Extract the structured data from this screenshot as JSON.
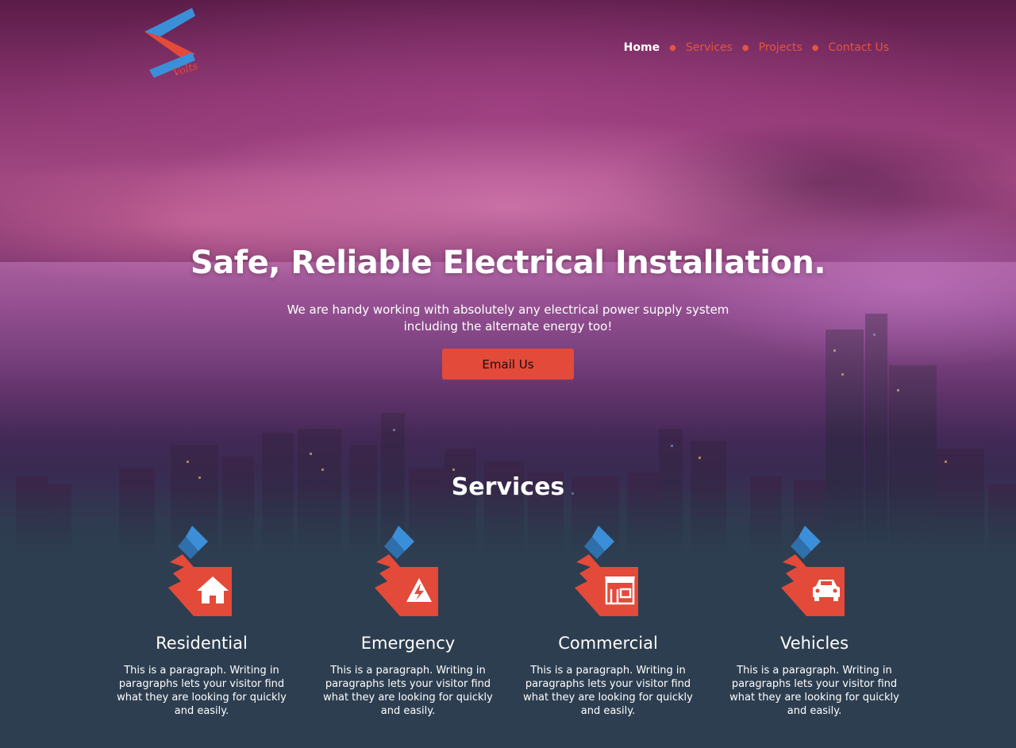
{
  "brand": {
    "logo_text": "Volts",
    "colors": {
      "accent": "#e34a3a",
      "blue": "#3b8fd8",
      "panel": "#2d3e50"
    }
  },
  "nav": {
    "items": [
      {
        "label": "Home",
        "active": true
      },
      {
        "label": "Services",
        "active": false
      },
      {
        "label": "Projects",
        "active": false
      },
      {
        "label": "Contact Us",
        "active": false
      }
    ]
  },
  "hero": {
    "title": "Safe, Reliable Electrical Installation.",
    "subtitle": "We are handy working with absolutely any electrical power supply system including the alternate energy too!",
    "cta_label": "Email Us"
  },
  "services": {
    "title": "Services",
    "items": [
      {
        "name": "Residential",
        "icon": "house-icon",
        "text": "This is a paragraph. Writing in paragraphs lets your visitor find what they are looking for quickly and easily."
      },
      {
        "name": "Emergency",
        "icon": "high-voltage-icon",
        "text": "This is a paragraph. Writing in paragraphs lets your visitor find what they are looking for quickly and easily."
      },
      {
        "name": "Commercial",
        "icon": "storefront-icon",
        "text": "This is a paragraph. Writing in paragraphs lets your visitor find what they are looking for quickly and easily."
      },
      {
        "name": "Vehicles",
        "icon": "car-icon",
        "text": "This is a paragraph. Writing in paragraphs lets your visitor find what they are looking for quickly and easily."
      }
    ]
  }
}
